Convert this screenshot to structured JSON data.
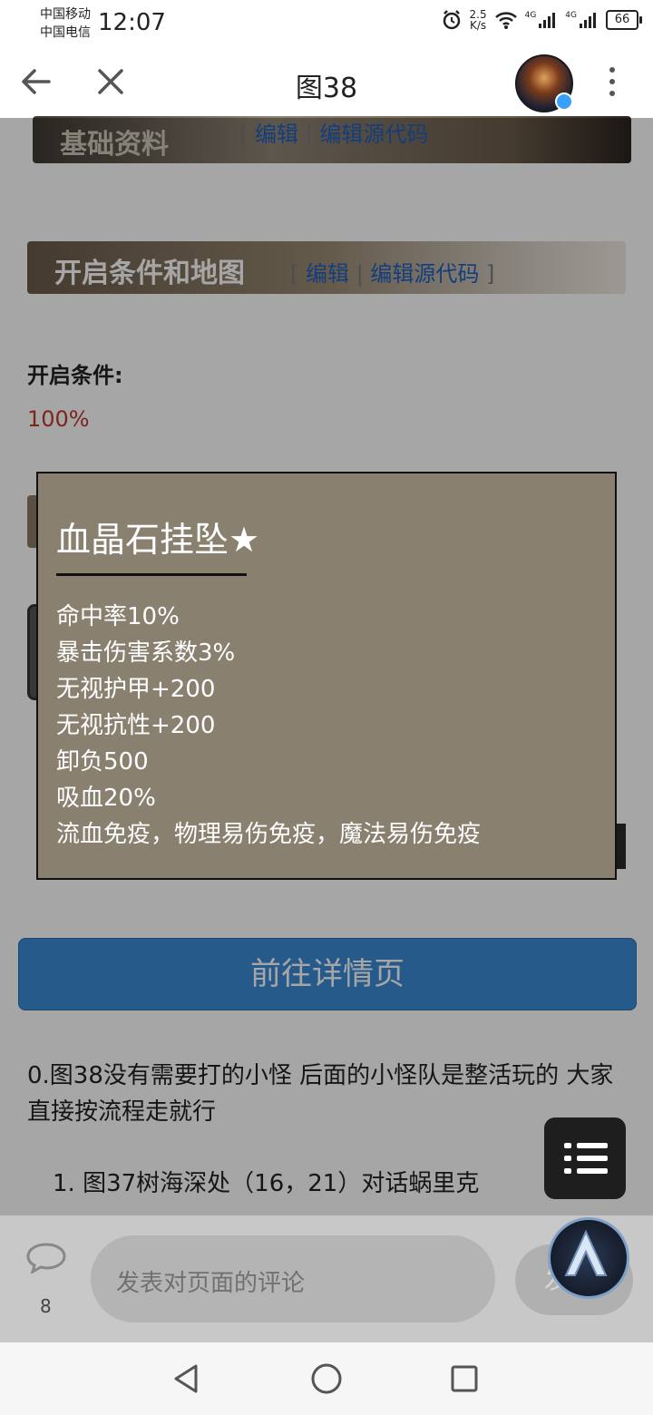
{
  "status": {
    "carrier1": "中国移动",
    "carrier2": "中国电信",
    "time": "12:07",
    "net_speed_value": "2.5",
    "net_speed_unit": "K/s",
    "signal1_label": "4G",
    "signal2_label": "4G",
    "battery": "66"
  },
  "nav": {
    "title": "图38"
  },
  "sections": {
    "basic_title": "基础资料",
    "open_title": "开启条件和地图",
    "edit_label": "编辑",
    "edit_source_label": "编辑源代码",
    "separator": "|",
    "bracket_open": "[",
    "bracket_close": "]"
  },
  "condition": {
    "label": "开启条件:",
    "value": "100%"
  },
  "tooltip": {
    "title": "血晶石挂坠★",
    "stats": [
      "命中率10%",
      "暴击伤害系数3%",
      "无视护甲+200",
      "无视抗性+200",
      "卸负500",
      "吸血20%",
      "流血免疫，物理易伤免疫，魔法易伤免疫"
    ]
  },
  "detail_button": "前往详情页",
  "paragraph": "0.图38没有需要打的小怪 后面的小怪队是整活玩的 大家直接按流程走就行",
  "list_item": "1. 图37树海深处（16，21）对话蜗里克",
  "comment": {
    "count": "8",
    "placeholder": "发表对页面的评论",
    "send_label": "发"
  },
  "colors": {
    "accent": "#3a8bd4",
    "tooltip_bg": "#8a8070",
    "condition_value": "#c0392b",
    "link": "#1f5fbf"
  }
}
